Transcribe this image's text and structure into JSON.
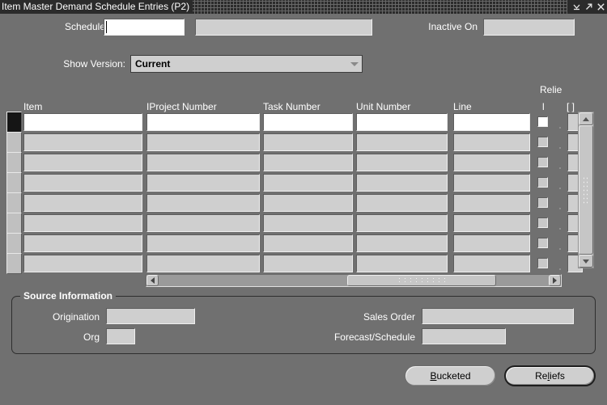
{
  "window": {
    "title": "Item Master Demand Schedule Entries (P2)",
    "controls": [
      {
        "name": "minimize-button",
        "glyph": "minimize"
      },
      {
        "name": "maximize-button",
        "glyph": "maximize"
      },
      {
        "name": "close-button",
        "glyph": "close"
      }
    ]
  },
  "header": {
    "schedule_label": "Schedule",
    "schedule_value": "",
    "schedule_desc_value": "",
    "inactive_on_label": "Inactive On",
    "inactive_on_value": "",
    "show_version_label": "Show Version:",
    "show_version_value": "Current",
    "show_version_options": [
      "Current"
    ]
  },
  "table": {
    "columns": [
      {
        "key": "item",
        "label": "Item"
      },
      {
        "key": "project_number",
        "label": "IProject Number"
      },
      {
        "key": "task_number",
        "label": "Task Number"
      },
      {
        "key": "unit_number",
        "label": "Unit Number"
      },
      {
        "key": "line",
        "label": "Line"
      },
      {
        "key": "reliefs",
        "label": "Relie",
        "sublabel": "l"
      },
      {
        "key": "extra",
        "label": "[  ]"
      }
    ],
    "rows": [
      {
        "item": "",
        "project_number": "",
        "task_number": "",
        "unit_number": "",
        "line": "",
        "reliefs": false,
        "current": true
      },
      {
        "item": "",
        "project_number": "",
        "task_number": "",
        "unit_number": "",
        "line": "",
        "reliefs": false,
        "current": false
      },
      {
        "item": "",
        "project_number": "",
        "task_number": "",
        "unit_number": "",
        "line": "",
        "reliefs": false,
        "current": false
      },
      {
        "item": "",
        "project_number": "",
        "task_number": "",
        "unit_number": "",
        "line": "",
        "reliefs": false,
        "current": false
      },
      {
        "item": "",
        "project_number": "",
        "task_number": "",
        "unit_number": "",
        "line": "",
        "reliefs": false,
        "current": false
      },
      {
        "item": "",
        "project_number": "",
        "task_number": "",
        "unit_number": "",
        "line": "",
        "reliefs": false,
        "current": false
      },
      {
        "item": "",
        "project_number": "",
        "task_number": "",
        "unit_number": "",
        "line": "",
        "reliefs": false,
        "current": false
      },
      {
        "item": "",
        "project_number": "",
        "task_number": "",
        "unit_number": "",
        "line": "",
        "reliefs": false,
        "current": false
      }
    ]
  },
  "source_information": {
    "title": "Source Information",
    "origination_label": "Origination",
    "origination_value": "",
    "org_label": "Org",
    "org_value": "",
    "sales_order_label": "Sales Order",
    "sales_order_value": "",
    "forecast_schedule_label": "Forecast/Schedule",
    "forecast_schedule_value": ""
  },
  "footer": {
    "bucketed_label": "Bucketed",
    "bucketed_mnemonic": "B",
    "reliefs_label": "Reliefs",
    "reliefs_mnemonic": "l"
  },
  "colors": {
    "window_background": "#707070",
    "titlebar_background": "#2b2b2b",
    "field_background": "#cfcfcf",
    "active_field_background": "#ffffff",
    "label_text": "#ffffff",
    "value_text": "#000000"
  }
}
